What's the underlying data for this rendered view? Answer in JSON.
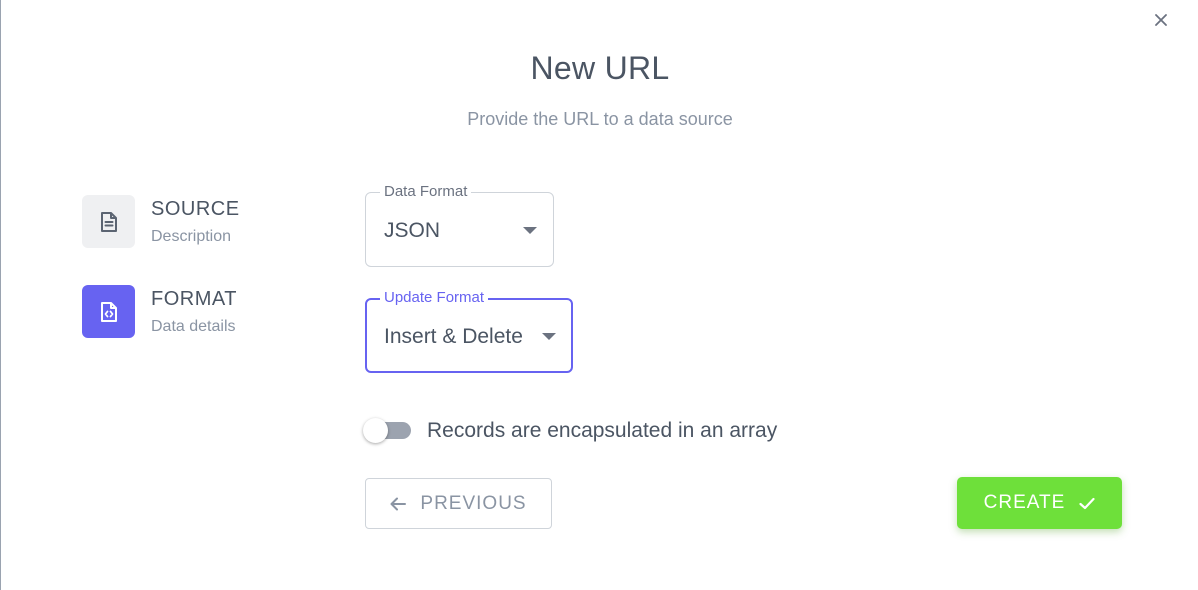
{
  "dialog": {
    "close_icon": "close-icon",
    "title": "New URL",
    "subtitle": "Provide the URL to a data source"
  },
  "steps": [
    {
      "icon": "document-icon",
      "title": "SOURCE",
      "description": "Description",
      "active": false
    },
    {
      "icon": "code-file-icon",
      "title": "FORMAT",
      "description": "Data details",
      "active": true
    }
  ],
  "form": {
    "data_format": {
      "label": "Data Format",
      "value": "JSON"
    },
    "update_format": {
      "label": "Update Format",
      "value": "Insert & Delete"
    },
    "array_toggle": {
      "label": "Records are encapsulated in an array",
      "checked": false
    }
  },
  "actions": {
    "previous_label": "PREVIOUS",
    "create_label": "CREATE"
  },
  "colors": {
    "accent": "#6763f1",
    "create": "#6ee03a"
  }
}
